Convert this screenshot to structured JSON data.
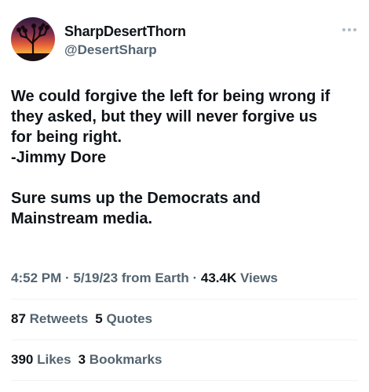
{
  "author": {
    "display_name": "SharpDesertThorn",
    "handle": "@DesertSharp"
  },
  "tweet": {
    "lines_para1": [
      "We could forgive the left for being wrong if",
      "they asked, but they will never forgive us",
      "for being right.",
      "-Jimmy Dore"
    ],
    "lines_para2": [
      "Sure sums up the Democrats and",
      "Mainstream media."
    ]
  },
  "meta": {
    "time": "4:52 PM",
    "sep1": " · ",
    "date": "5/19/23",
    "source": " from Earth",
    "sep2": " · ",
    "views_count": "43.4K",
    "views_label": " Views"
  },
  "stats": {
    "retweets_count": "87",
    "retweets_label": "Retweets",
    "quotes_count": "5",
    "quotes_label": "Quotes",
    "likes_count": "390",
    "likes_label": "Likes",
    "bookmarks_count": "3",
    "bookmarks_label": "Bookmarks"
  },
  "colors": {
    "text_primary": "#0f1419",
    "text_secondary": "#536471",
    "divider": "#eff3f4"
  },
  "icons": {
    "avatar": "joshua-tree-sunset-avatar",
    "more": "more-horizontal-icon"
  }
}
